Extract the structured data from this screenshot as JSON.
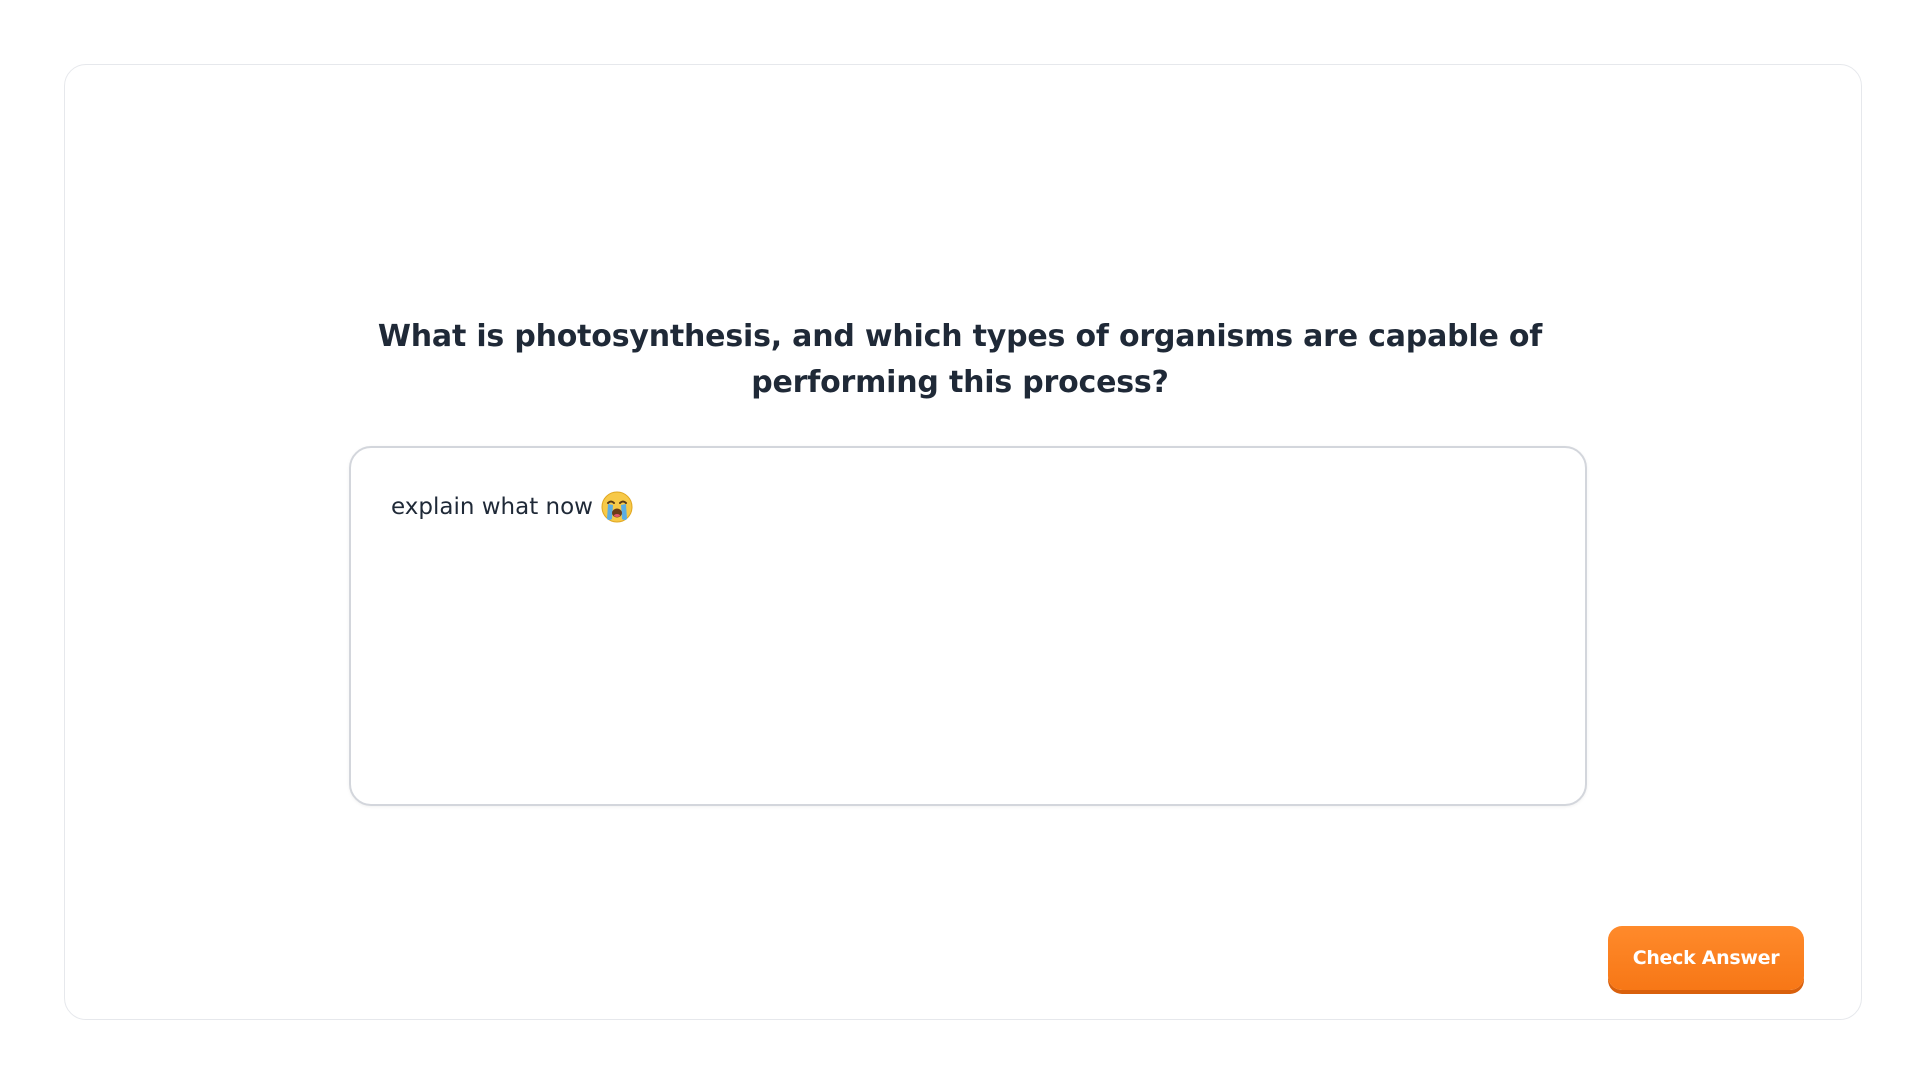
{
  "question": {
    "text": "What is photosynthesis, and which types of organisms are capable of performing this process?"
  },
  "answer": {
    "value": "explain what now",
    "emoji": "loudly-crying-face-icon"
  },
  "actions": {
    "check_label": "Check Answer"
  },
  "colors": {
    "accent": "#f77716",
    "text": "#1f2937",
    "border": "#d3d6dc"
  }
}
